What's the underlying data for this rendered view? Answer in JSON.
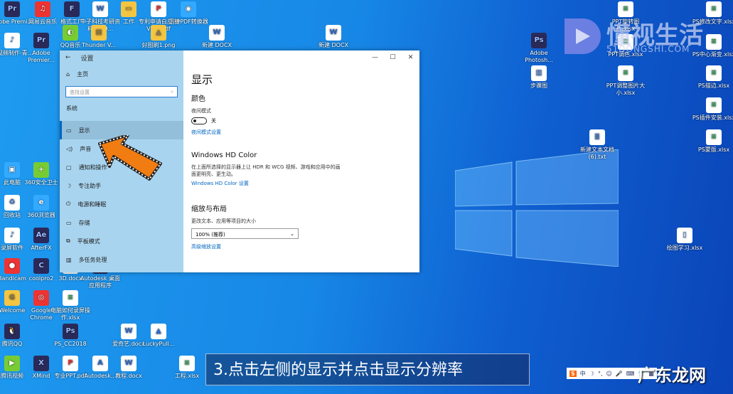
{
  "desktop_icons": [
    "Adobe Premi...",
    "网易云音乐",
    "格式工厂",
    "中子科技考研资料0820...",
    "工作",
    "专利申请白皮书V5.0.pdf",
    "迅捷PDF转换器",
    "短视频制作-青...",
    "Adobe Premier...",
    "QQ音乐",
    "Thunder V...",
    "好图刷1.png",
    "新建 DOCX",
    "新建 DOCX",
    "Adobe Photosh...",
    "步骤图",
    "PPT旋转图片.xlsx",
    "PPT调色.xlsx",
    "PPT调整图片大小.xlsx",
    "PS修改文字.xlsx",
    "PS中心渐变.xlsx",
    "PS描边.xlsx",
    "PS插件安装.xlsx",
    "PS蒙版.xlsx",
    "新建文本文档(6).txt",
    "绘图学习.xlsx",
    "Bandicam",
    "coolpro2",
    "3D.docx",
    "Autodesk 桌面应用程序",
    "Welcome",
    "Google Chrome",
    "电脑如何录屏操作.xlsx",
    "腾讯QQ",
    "PS_CC2018",
    "爱奇艺.docx",
    "LuckyPull...",
    "腾讯视频",
    "XMind",
    "专业PPT.pdf",
    "Autodesk...",
    "教程.docx",
    "工程.xlsx",
    "此电脑",
    "360安全卫士",
    "回收站",
    "360浏览器",
    "AfterFX",
    "录屏软件"
  ],
  "window": {
    "title": "设置",
    "home": "主页",
    "search_placeholder": "查找设置",
    "section": "系统",
    "nav": [
      "显示",
      "声音",
      "通知和操作",
      "专注助手",
      "电源和睡眠",
      "存储",
      "平板模式",
      "多任务处理"
    ],
    "controls": [
      "—",
      "☐",
      "✕"
    ],
    "page_title": "显示",
    "color_heading": "颜色",
    "night_light_label": "夜间模式",
    "toggle_state": "关",
    "night_link": "夜间模式设置",
    "hd_heading": "Windows HD Color",
    "hd_desc": "在上面所选择的显示器上让 HDR 和 WCG 视频、游戏和应用中的画面更明亮、更生动。",
    "hd_link": "Windows HD Color 设置",
    "scale_heading": "缩放与布局",
    "scale_label": "更改文本、应用等项目的大小",
    "scale_value": "100% (推荐)",
    "advanced_link": "高级缩放设置"
  },
  "caption": "3.点击左侧的显示并点击显示分辨率",
  "watermark": {
    "name": "懂视生活",
    "url": "51DONGSHI.COM"
  },
  "ime": {
    "logo": "S",
    "items": [
      "中",
      "☽",
      "°,",
      "☺",
      "🎤",
      "⌨",
      "👕",
      "▦"
    ]
  },
  "site": "广东龙网",
  "colors": {
    "accent": "#0067c0",
    "arrow": "#f07c12"
  }
}
